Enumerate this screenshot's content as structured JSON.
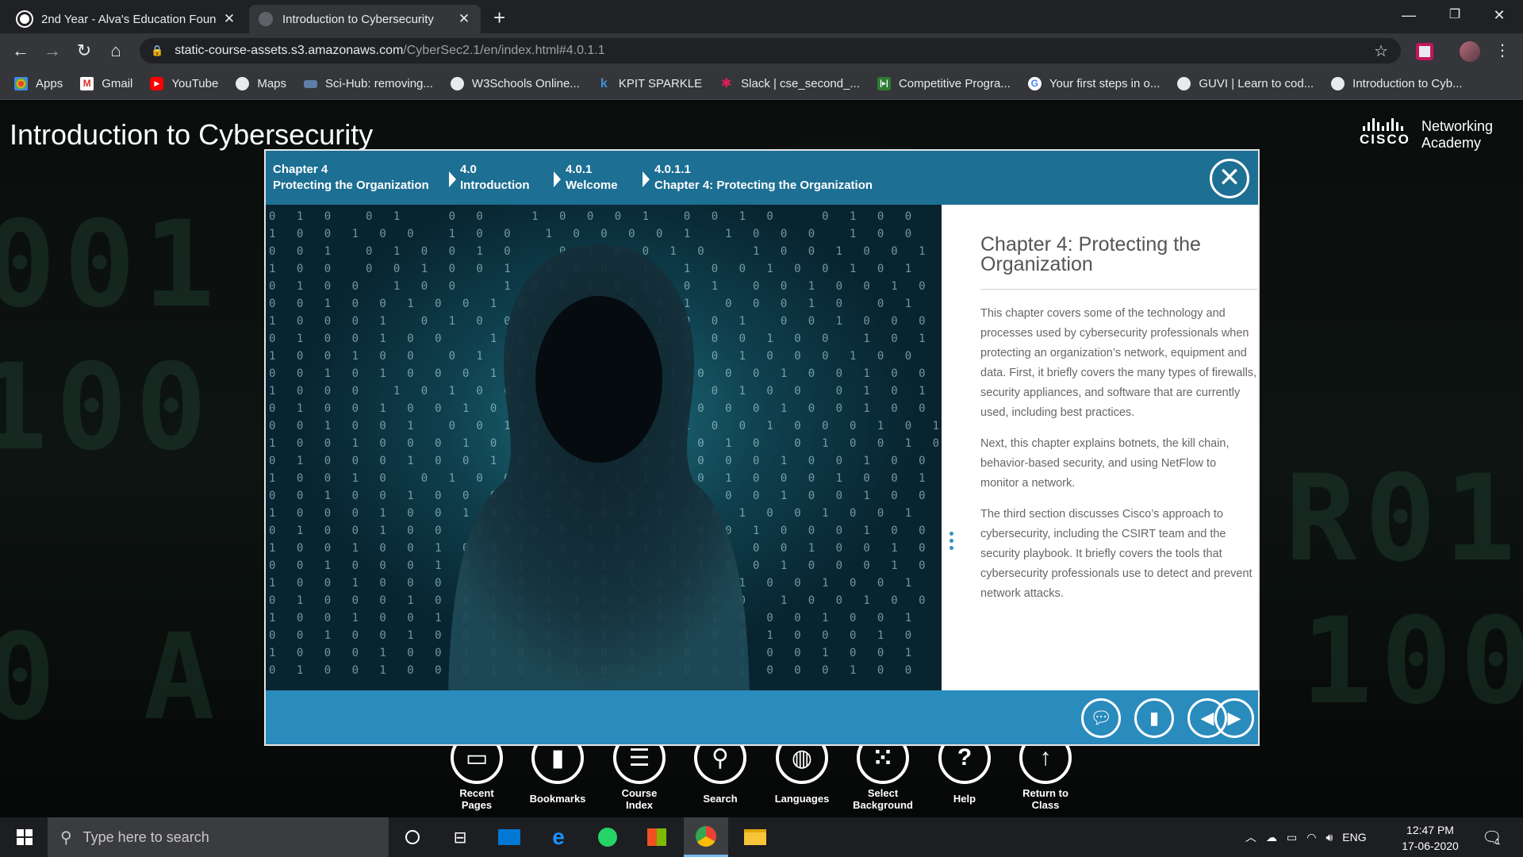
{
  "browser": {
    "tabs": [
      {
        "title": "2nd Year - Alva's Education Foun",
        "active": false,
        "icon": "github-icon"
      },
      {
        "title": "Introduction to Cybersecurity",
        "active": true,
        "icon": "globe-icon"
      }
    ],
    "url_host": "static-course-assets.s3.amazonaws.com",
    "url_path": "/CyberSec2.1/en/index.html#4.0.1.1",
    "bookmarks": [
      {
        "label": "Apps",
        "icon": "apps-grid-icon"
      },
      {
        "label": "Gmail",
        "icon": "gmail-icon"
      },
      {
        "label": "YouTube",
        "icon": "youtube-icon"
      },
      {
        "label": "Maps",
        "icon": "maps-icon"
      },
      {
        "label": "Sci-Hub: removing...",
        "icon": "scihub-icon"
      },
      {
        "label": "W3Schools Online...",
        "icon": "globe-icon"
      },
      {
        "label": "KPIT SPARKLE",
        "icon": "kpit-icon"
      },
      {
        "label": "Slack | cse_second_...",
        "icon": "slack-icon"
      },
      {
        "label": "Competitive Progra...",
        "icon": "hackerrank-icon"
      },
      {
        "label": "Your first steps in o...",
        "icon": "google-icon"
      },
      {
        "label": "GUVI | Learn to cod...",
        "icon": "globe-icon"
      },
      {
        "label": "Introduction to Cyb...",
        "icon": "globe-icon"
      }
    ]
  },
  "page": {
    "course_title": "Introduction to Cybersecurity",
    "logo_word": "CISCO",
    "logo_line1": "Networking",
    "logo_line2": "Academy"
  },
  "modal": {
    "breadcrumbs": [
      {
        "num": "Chapter 4",
        "label": "Protecting the Organization"
      },
      {
        "num": "4.0",
        "label": "Introduction"
      },
      {
        "num": "4.0.1",
        "label": "Welcome"
      },
      {
        "num": "4.0.1.1",
        "label": "Chapter 4: Protecting the Organization"
      }
    ],
    "heading": "Chapter 4: Protecting the Organization",
    "paragraphs": [
      "This chapter covers some of the technology and processes used by cybersecurity professionals when protecting an organization’s network, equipment and data. First, it briefly covers the many types of firewalls, security appliances, and software that are currently used, including best practices.",
      "Next, this chapter explains botnets, the kill chain, behavior-based security, and using NetFlow to monitor a network.",
      "The third section discusses Cisco’s approach to cybersecurity, including the CSIRT team and the security playbook. It briefly covers the tools that cybersecurity professionals use to detect and prevent network attacks."
    ]
  },
  "course_toolbar": [
    {
      "label1": "Recent",
      "label2": "Pages",
      "icon": "recent-pages-icon"
    },
    {
      "label1": "Bookmarks",
      "label2": "",
      "icon": "bookmark-icon"
    },
    {
      "label1": "Course",
      "label2": "Index",
      "icon": "menu-lines-icon"
    },
    {
      "label1": "Search",
      "label2": "",
      "icon": "search-icon"
    },
    {
      "label1": "Languages",
      "label2": "",
      "icon": "globe-icon"
    },
    {
      "label1": "Select",
      "label2": "Background",
      "icon": "dots-grid-icon"
    },
    {
      "label1": "Help",
      "label2": "",
      "icon": "question-icon"
    },
    {
      "label1": "Return to",
      "label2": "Class",
      "icon": "arrow-up-icon"
    }
  ],
  "taskbar": {
    "search_placeholder": "Type here to search",
    "language": "ENG",
    "time": "12:47 PM",
    "date": "17-06-2020",
    "notifications": "1"
  },
  "colors": {
    "modal_header": "#1d6f93",
    "modal_footer": "#2a8bbd",
    "accent_dots": "#2b94c4"
  }
}
